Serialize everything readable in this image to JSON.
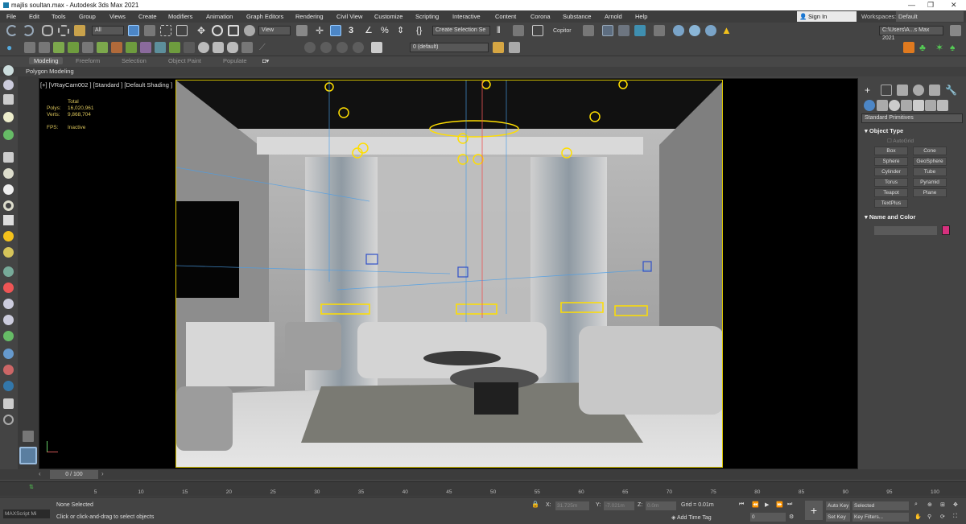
{
  "window": {
    "title": "majlis soultan.max - Autodesk 3ds Max 2021"
  },
  "menu": [
    "File",
    "Edit",
    "Tools",
    "Group",
    "Views",
    "Create",
    "Modifiers",
    "Animation",
    "Graph Editors",
    "Rendering",
    "Civil View",
    "Customize",
    "Scripting",
    "Interactive",
    "Content",
    "Corona",
    "Substance",
    "Arnold",
    "Help"
  ],
  "account": {
    "signin": "Sign In",
    "workspaces_label": "Workspaces:",
    "workspace": "Default"
  },
  "toolbar": {
    "filter": "All",
    "ref_coord": "View",
    "selection_set": "Create Selection Se",
    "copitor": "Copitor",
    "path": "C:\\Users\\A...s Max 2021",
    "layer": "0 (default)"
  },
  "ribbon": {
    "tabs": [
      "Modeling",
      "Freeform",
      "Selection",
      "Object Paint",
      "Populate"
    ],
    "active": "Modeling",
    "sub": "Polygon Modeling"
  },
  "viewport": {
    "label": "[+] [VRayCam002 ] [Standard ] [Default Shading ]",
    "stats": {
      "total": "Total",
      "polys_label": "Polys:",
      "polys": "16,020,961",
      "verts_label": "Verts:",
      "verts": "9,868,704",
      "fps_label": "FPS:",
      "fps": "Inactive"
    }
  },
  "command_panel": {
    "dropdown": "Standard Primitives",
    "object_type": "Object Type",
    "autogrid": "AutoGrid",
    "buttons": [
      "Box",
      "Cone",
      "Sphere",
      "GeoSphere",
      "Cylinder",
      "Tube",
      "Torus",
      "Pyramid",
      "Teapot",
      "Plane",
      "TextPlus"
    ],
    "name_color": "Name and Color",
    "swatch": "#d6307d"
  },
  "timeline": {
    "frame": "0 / 100",
    "ticks": [
      "0",
      "5",
      "10",
      "15",
      "20",
      "25",
      "30",
      "35",
      "40",
      "45",
      "50",
      "55",
      "60",
      "65",
      "70",
      "75",
      "80",
      "85",
      "90",
      "95",
      "100"
    ]
  },
  "status": {
    "maxscript": "MAXScript Mi",
    "selected": "None Selected",
    "prompt": "Click or click-and-drag to select objects",
    "x_label": "X:",
    "x": "31.725m",
    "y_label": "Y:",
    "y": "-7.021m",
    "z_label": "Z:",
    "z": "0.0m",
    "grid": "Grid = 0.01m",
    "add_time_tag": "Add Time Tag",
    "frame_field": "0",
    "auto_key": "Auto Key",
    "set_key": "Set Key",
    "selected_mode": "Selected",
    "key_filters": "Key Filters..."
  },
  "colors": {
    "accent": "#d6307d",
    "gizmo_yellow": "#ffde00",
    "frame_yellow": "#d8c400"
  }
}
